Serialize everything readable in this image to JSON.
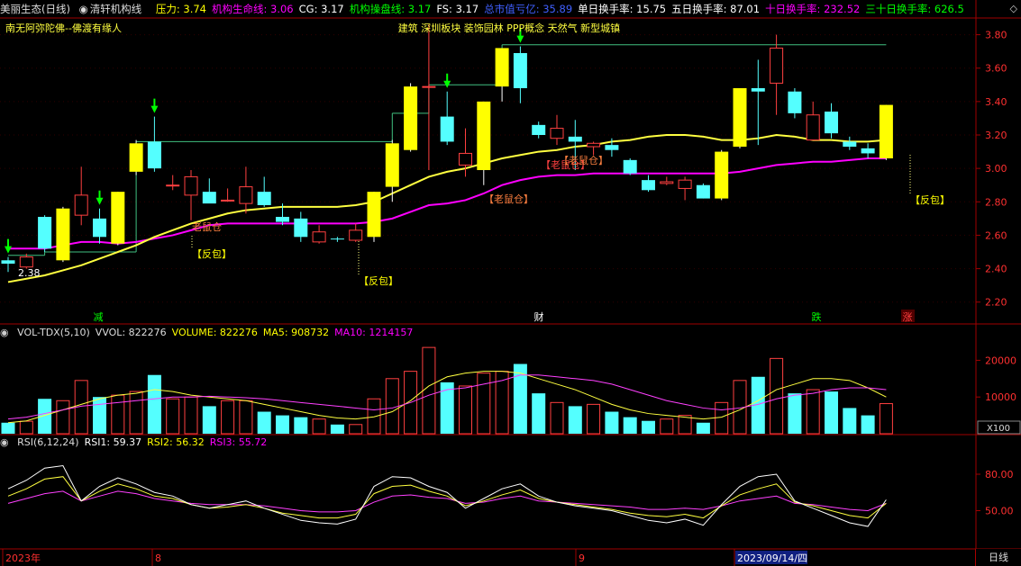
{
  "header": {
    "stock_name": "美丽生态(日线)",
    "indicator_name": "清轩机构线",
    "items": [
      {
        "label": "压力:",
        "value": "3.74",
        "color": "#ffff00"
      },
      {
        "label": "机构生命线:",
        "value": "3.06",
        "color": "#ff00ff"
      },
      {
        "label": "CG:",
        "value": "3.17",
        "color": "#ffffff"
      },
      {
        "label": "机构操盘线:",
        "value": "3.17",
        "color": "#00ff00"
      },
      {
        "label": "FS:",
        "value": "3.17",
        "color": "#ffffff"
      },
      {
        "label": "总市值亏亿:",
        "value": "35.89",
        "color": "#4060ff"
      },
      {
        "label": "单日换手率:",
        "value": "15.75",
        "color": "#ffffff"
      },
      {
        "label": "五日换手率:",
        "value": "87.01",
        "color": "#ffffff"
      },
      {
        "label": "十日换手率:",
        "value": "232.52",
        "color": "#ff00ff"
      },
      {
        "label": "三十日换手率:",
        "value": "626.5",
        "color": "#00ff00"
      }
    ],
    "buttons": "◇"
  },
  "main_chart": {
    "subtitle": "南无阿弥陀佛--佛渡有缘人",
    "concepts": "建筑 深圳板块 装饰园林 PPP概念 天然气 新型城镇",
    "y_ticks": [
      "3.80",
      "3.60",
      "3.40",
      "3.20",
      "3.00",
      "2.80",
      "2.60",
      "2.40",
      "2.20"
    ],
    "labels": [
      {
        "text": "2.38",
        "color": "#ffffff"
      },
      {
        "text": "【反包】",
        "color": "#ffff00"
      },
      {
        "text": "【反包】",
        "color": "#ffff00"
      },
      {
        "text": "【反包】",
        "color": "#ffff00"
      },
      {
        "text": "老鼠仓",
        "color": "#ff8040"
      },
      {
        "text": "【老鼠仓】",
        "color": "#ff8040"
      },
      {
        "text": "【老鼠仓】",
        "color": "#ff4040"
      },
      {
        "text": "【老鼠仓】",
        "color": "#ff8040"
      }
    ],
    "markers": [
      {
        "text": "减",
        "color": "#00ff00"
      },
      {
        "text": "财",
        "color": "#ffffff"
      },
      {
        "text": "跌",
        "color": "#00ff00"
      },
      {
        "text": "涨",
        "color": "#ff4040"
      }
    ]
  },
  "vol_panel": {
    "items": [
      {
        "label": "VOL-TDX(5,10)",
        "value": "",
        "color": "#dddddd"
      },
      {
        "label": "VVOL:",
        "value": "822276",
        "color": "#dddddd"
      },
      {
        "label": "VOLUME:",
        "value": "822276",
        "color": "#ffff00"
      },
      {
        "label": "MA5:",
        "value": "908732",
        "color": "#ffff00"
      },
      {
        "label": "MA10:",
        "value": "1214157",
        "color": "#ff00ff"
      }
    ],
    "y_ticks": [
      "20000",
      "10000"
    ],
    "unit": "X100"
  },
  "rsi_panel": {
    "items": [
      {
        "label": "RSI(6,12,24)",
        "value": "",
        "color": "#dddddd"
      },
      {
        "label": "RSI1:",
        "value": "59.37",
        "color": "#ffffff"
      },
      {
        "label": "RSI2:",
        "value": "56.32",
        "color": "#ffff00"
      },
      {
        "label": "RSI3:",
        "value": "55.72",
        "color": "#ff00ff"
      }
    ],
    "y_ticks": [
      "80.00",
      "50.00"
    ]
  },
  "time_axis": {
    "labels": [
      "2023年",
      "8",
      "9",
      "2023/09/14/四"
    ],
    "period": "日线"
  },
  "chart_data": {
    "type": "candlestick",
    "y_range": [
      2.15,
      3.9
    ],
    "candles": [
      {
        "o": 2.43,
        "h": 2.47,
        "l": 2.38,
        "c": 2.45,
        "up": false
      },
      {
        "o": 2.41,
        "h": 2.49,
        "l": 2.4,
        "c": 2.47,
        "up": true
      },
      {
        "o": 2.52,
        "h": 2.72,
        "l": 2.5,
        "c": 2.71,
        "up": false
      },
      {
        "o": 2.45,
        "h": 2.77,
        "l": 2.44,
        "c": 2.76,
        "up": true,
        "hollow": false
      },
      {
        "o": 2.72,
        "h": 3.01,
        "l": 2.66,
        "c": 2.84,
        "up": true
      },
      {
        "o": 2.7,
        "h": 2.76,
        "l": 2.55,
        "c": 2.59,
        "up": false
      },
      {
        "o": 2.55,
        "h": 2.86,
        "l": 2.54,
        "c": 2.86,
        "up": true,
        "hollow": false
      },
      {
        "o": 2.98,
        "h": 3.17,
        "l": 2.96,
        "c": 3.15,
        "up": true,
        "hollow": false
      },
      {
        "o": 3.16,
        "h": 3.31,
        "l": 2.98,
        "c": 3.0,
        "up": false
      },
      {
        "o": 2.9,
        "h": 2.96,
        "l": 2.87,
        "c": 2.9,
        "up": true
      },
      {
        "o": 2.84,
        "h": 2.99,
        "l": 2.69,
        "c": 2.95,
        "up": true
      },
      {
        "o": 2.86,
        "h": 2.94,
        "l": 2.8,
        "c": 2.79,
        "up": false
      },
      {
        "o": 2.81,
        "h": 2.88,
        "l": 2.8,
        "c": 2.81,
        "up": true
      },
      {
        "o": 2.79,
        "h": 3.01,
        "l": 2.73,
        "c": 2.89,
        "up": true
      },
      {
        "o": 2.86,
        "h": 2.95,
        "l": 2.77,
        "c": 2.78,
        "up": false
      },
      {
        "o": 2.71,
        "h": 2.79,
        "l": 2.66,
        "c": 2.68,
        "up": false
      },
      {
        "o": 2.7,
        "h": 2.74,
        "l": 2.56,
        "c": 2.59,
        "up": false
      },
      {
        "o": 2.56,
        "h": 2.66,
        "l": 2.55,
        "c": 2.62,
        "up": true
      },
      {
        "o": 2.58,
        "h": 2.59,
        "l": 2.56,
        "c": 2.58,
        "up": false
      },
      {
        "o": 2.57,
        "h": 2.67,
        "l": 2.56,
        "c": 2.63,
        "up": true
      },
      {
        "o": 2.59,
        "h": 2.86,
        "l": 2.56,
        "c": 2.86,
        "up": true,
        "hollow": false
      },
      {
        "o": 2.89,
        "h": 3.17,
        "l": 2.8,
        "c": 3.15,
        "up": true,
        "hollow": false
      },
      {
        "o": 3.11,
        "h": 3.51,
        "l": 3.1,
        "c": 3.49,
        "up": true,
        "hollow": false
      },
      {
        "o": 3.49,
        "h": 3.86,
        "l": 2.99,
        "c": 3.49,
        "up": true
      },
      {
        "o": 3.31,
        "h": 3.46,
        "l": 3.14,
        "c": 3.16,
        "up": false
      },
      {
        "o": 3.09,
        "h": 3.24,
        "l": 2.95,
        "c": 3.02,
        "up": true
      },
      {
        "o": 2.99,
        "h": 3.4,
        "l": 2.9,
        "c": 3.4,
        "up": true,
        "hollow": false
      },
      {
        "o": 3.49,
        "h": 3.71,
        "l": 3.4,
        "c": 3.72,
        "up": true,
        "hollow": false
      },
      {
        "o": 3.69,
        "h": 3.73,
        "l": 3.39,
        "c": 3.48,
        "up": false
      },
      {
        "o": 3.26,
        "h": 3.28,
        "l": 3.18,
        "c": 3.2,
        "up": false
      },
      {
        "o": 3.24,
        "h": 3.32,
        "l": 3.14,
        "c": 3.18,
        "up": true
      },
      {
        "o": 3.19,
        "h": 3.29,
        "l": 2.99,
        "c": 3.16,
        "up": false
      },
      {
        "o": 3.13,
        "h": 3.16,
        "l": 3.08,
        "c": 3.15,
        "up": true
      },
      {
        "o": 3.14,
        "h": 3.18,
        "l": 3.07,
        "c": 3.11,
        "up": false
      },
      {
        "o": 3.05,
        "h": 3.06,
        "l": 2.96,
        "c": 2.97,
        "up": false
      },
      {
        "o": 2.93,
        "h": 2.96,
        "l": 2.86,
        "c": 2.87,
        "up": false
      },
      {
        "o": 2.92,
        "h": 2.95,
        "l": 2.9,
        "c": 2.91,
        "up": true
      },
      {
        "o": 2.93,
        "h": 2.95,
        "l": 2.81,
        "c": 2.88,
        "up": true
      },
      {
        "o": 2.9,
        "h": 2.91,
        "l": 2.82,
        "c": 2.82,
        "up": false
      },
      {
        "o": 2.82,
        "h": 3.11,
        "l": 2.81,
        "c": 3.1,
        "up": true,
        "hollow": false
      },
      {
        "o": 3.13,
        "h": 3.48,
        "l": 3.12,
        "c": 3.48,
        "up": true,
        "hollow": false
      },
      {
        "o": 3.48,
        "h": 3.65,
        "l": 3.14,
        "c": 3.46,
        "up": false
      },
      {
        "o": 3.51,
        "h": 3.8,
        "l": 3.32,
        "c": 3.72,
        "up": true
      },
      {
        "o": 3.46,
        "h": 3.48,
        "l": 3.3,
        "c": 3.33,
        "up": false
      },
      {
        "o": 3.32,
        "h": 3.4,
        "l": 3.17,
        "c": 3.17,
        "up": true
      },
      {
        "o": 3.34,
        "h": 3.39,
        "l": 3.18,
        "c": 3.21,
        "up": false
      },
      {
        "o": 3.16,
        "h": 3.19,
        "l": 3.11,
        "c": 3.13,
        "up": false
      },
      {
        "o": 3.12,
        "h": 3.15,
        "l": 3.06,
        "c": 3.09,
        "up": false
      },
      {
        "o": 3.06,
        "h": 3.38,
        "l": 3.05,
        "c": 3.38,
        "up": true,
        "hollow": false
      }
    ],
    "pressure_line": [
      {
        "from": 0,
        "to": 2,
        "v": 2.48
      },
      {
        "from": 2,
        "to": 7,
        "v": 2.5
      },
      {
        "from": 7,
        "to": 8,
        "v": 3.16
      },
      {
        "from": 8,
        "to": 21,
        "v": 3.16
      },
      {
        "from": 21,
        "to": 23,
        "v": 3.33
      },
      {
        "from": 23,
        "to": 27,
        "v": 3.5
      },
      {
        "from": 27,
        "to": 48,
        "v": 3.74
      }
    ],
    "life_line": [
      2.52,
      2.52,
      2.52,
      2.54,
      2.56,
      2.56,
      2.55,
      2.56,
      2.58,
      2.6,
      2.63,
      2.66,
      2.67,
      2.67,
      2.67,
      2.67,
      2.67,
      2.67,
      2.67,
      2.67,
      2.68,
      2.7,
      2.74,
      2.78,
      2.79,
      2.81,
      2.85,
      2.9,
      2.93,
      2.95,
      2.96,
      2.96,
      2.97,
      2.97,
      2.97,
      2.97,
      2.97,
      2.97,
      2.97,
      2.97,
      2.98,
      3.0,
      3.02,
      3.03,
      3.04,
      3.04,
      3.05,
      3.06,
      3.06
    ],
    "cg_line": [
      2.32,
      2.34,
      2.36,
      2.39,
      2.42,
      2.46,
      2.5,
      2.54,
      2.59,
      2.63,
      2.67,
      2.7,
      2.73,
      2.75,
      2.76,
      2.77,
      2.77,
      2.77,
      2.77,
      2.78,
      2.8,
      2.85,
      2.9,
      2.95,
      2.98,
      3.0,
      3.03,
      3.06,
      3.08,
      3.1,
      3.11,
      3.13,
      3.14,
      3.16,
      3.17,
      3.19,
      3.2,
      3.2,
      3.19,
      3.17,
      3.17,
      3.18,
      3.2,
      3.19,
      3.17,
      3.17,
      3.16,
      3.16,
      3.17
    ],
    "volume": [
      {
        "v": 3000,
        "up": false
      },
      {
        "v": 3400,
        "up": true
      },
      {
        "v": 9500,
        "up": false
      },
      {
        "v": 9000,
        "up": true
      },
      {
        "v": 14500,
        "up": true
      },
      {
        "v": 10000,
        "up": false
      },
      {
        "v": 10500,
        "up": true
      },
      {
        "v": 11500,
        "up": true
      },
      {
        "v": 16000,
        "up": false
      },
      {
        "v": 9500,
        "up": true
      },
      {
        "v": 10000,
        "up": true
      },
      {
        "v": 7500,
        "up": false
      },
      {
        "v": 9000,
        "up": true
      },
      {
        "v": 9000,
        "up": true
      },
      {
        "v": 6000,
        "up": false
      },
      {
        "v": 5000,
        "up": false
      },
      {
        "v": 4500,
        "up": false
      },
      {
        "v": 4000,
        "up": true
      },
      {
        "v": 2500,
        "up": false
      },
      {
        "v": 2500,
        "up": true
      },
      {
        "v": 9500,
        "up": true
      },
      {
        "v": 15000,
        "up": true
      },
      {
        "v": 17000,
        "up": true
      },
      {
        "v": 23500,
        "up": true
      },
      {
        "v": 14000,
        "up": false
      },
      {
        "v": 13000,
        "up": true
      },
      {
        "v": 16500,
        "up": true
      },
      {
        "v": 17000,
        "up": true
      },
      {
        "v": 19000,
        "up": false
      },
      {
        "v": 11000,
        "up": false
      },
      {
        "v": 8500,
        "up": true
      },
      {
        "v": 7500,
        "up": false
      },
      {
        "v": 8000,
        "up": true
      },
      {
        "v": 6000,
        "up": false
      },
      {
        "v": 4500,
        "up": false
      },
      {
        "v": 3500,
        "up": false
      },
      {
        "v": 4000,
        "up": true
      },
      {
        "v": 5000,
        "up": true
      },
      {
        "v": 3000,
        "up": false
      },
      {
        "v": 8500,
        "up": true
      },
      {
        "v": 14500,
        "up": true
      },
      {
        "v": 15500,
        "up": false
      },
      {
        "v": 20500,
        "up": true
      },
      {
        "v": 11000,
        "up": false
      },
      {
        "v": 12000,
        "up": true
      },
      {
        "v": 11500,
        "up": false
      },
      {
        "v": 7000,
        "up": false
      },
      {
        "v": 5000,
        "up": false
      },
      {
        "v": 8200,
        "up": true
      }
    ],
    "vol_range": [
      0,
      25000
    ],
    "vol_ma5": [
      3000,
      3500,
      5000,
      6500,
      8000,
      9500,
      10500,
      11000,
      12000,
      11500,
      10500,
      10000,
      9500,
      9000,
      8000,
      7000,
      6000,
      5000,
      4300,
      4000,
      4600,
      6000,
      9000,
      13000,
      15500,
      16500,
      17000,
      17000,
      16500,
      15000,
      13500,
      12000,
      10000,
      8000,
      6500,
      5500,
      5000,
      4500,
      4000,
      4500,
      6500,
      9000,
      12000,
      13500,
      15000,
      15000,
      14500,
      12500,
      10000
    ],
    "vol_ma10": [
      4000,
      4500,
      5500,
      6500,
      7500,
      8000,
      8500,
      9000,
      9500,
      10000,
      10000,
      10200,
      10000,
      9800,
      9500,
      9000,
      8500,
      8000,
      7500,
      7000,
      6500,
      7000,
      8500,
      10500,
      12000,
      12500,
      13500,
      14500,
      16000,
      16000,
      15500,
      15000,
      14500,
      13500,
      12000,
      10500,
      9000,
      8000,
      7000,
      6500,
      7000,
      8000,
      9500,
      10500,
      11000,
      12000,
      12500,
      12500,
      12000
    ],
    "rsi_range": [
      20,
      100
    ],
    "rsi1": [
      68,
      75,
      85,
      87,
      58,
      70,
      77,
      72,
      65,
      62,
      55,
      52,
      55,
      58,
      52,
      47,
      42,
      40,
      39,
      43,
      70,
      78,
      77,
      70,
      65,
      52,
      60,
      68,
      72,
      62,
      57,
      54,
      52,
      50,
      46,
      42,
      40,
      43,
      38,
      55,
      70,
      78,
      80,
      58,
      52,
      46,
      40,
      37,
      59
    ],
    "rsi2": [
      62,
      68,
      76,
      78,
      58,
      66,
      72,
      68,
      62,
      60,
      55,
      52,
      53,
      55,
      52,
      48,
      46,
      44,
      44,
      47,
      64,
      70,
      71,
      66,
      62,
      54,
      58,
      63,
      67,
      60,
      57,
      55,
      53,
      51,
      48,
      46,
      45,
      47,
      44,
      54,
      63,
      68,
      72,
      57,
      54,
      50,
      46,
      44,
      56
    ],
    "rsi3": [
      56,
      60,
      64,
      66,
      58,
      62,
      66,
      64,
      60,
      58,
      56,
      55,
      55,
      55,
      54,
      52,
      50,
      49,
      49,
      50,
      57,
      62,
      63,
      61,
      60,
      56,
      57,
      60,
      62,
      58,
      57,
      56,
      55,
      54,
      53,
      51,
      51,
      52,
      51,
      54,
      58,
      60,
      62,
      56,
      55,
      53,
      51,
      50,
      56
    ]
  }
}
